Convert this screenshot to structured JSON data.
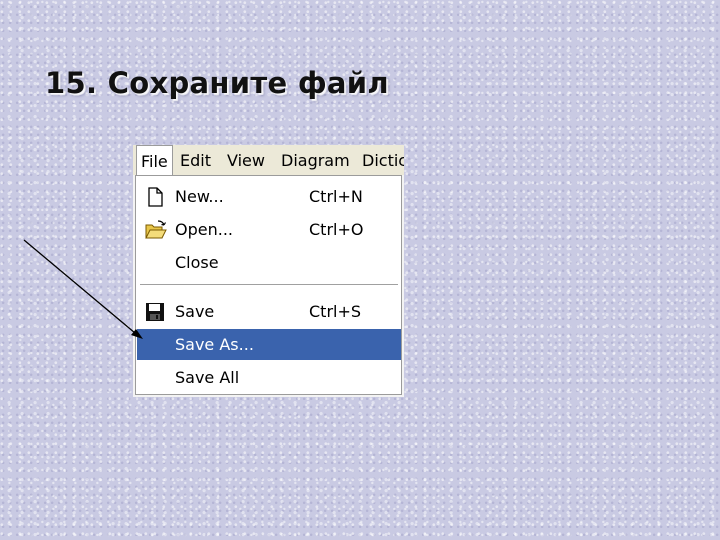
{
  "slide": {
    "title": "15. Сохраните файл"
  },
  "menubar": {
    "file": "File",
    "edit": "Edit",
    "view": "View",
    "diagram": "Diagram",
    "dictionary": "Dictic"
  },
  "menu": {
    "new": {
      "label": "New...",
      "shortcut": "Ctrl+N",
      "icon": "new-document-icon"
    },
    "open": {
      "label": "Open...",
      "shortcut": "Ctrl+O",
      "icon": "open-folder-icon"
    },
    "close": {
      "label": "Close"
    },
    "save": {
      "label": "Save",
      "shortcut": "Ctrl+S",
      "icon": "floppy-disk-icon"
    },
    "save_as": {
      "label": "Save As..."
    },
    "save_all": {
      "label": "Save All"
    }
  },
  "colors": {
    "highlight": "#3a63ad",
    "menubar": "#ece9d8",
    "background": "#c9cae3"
  }
}
